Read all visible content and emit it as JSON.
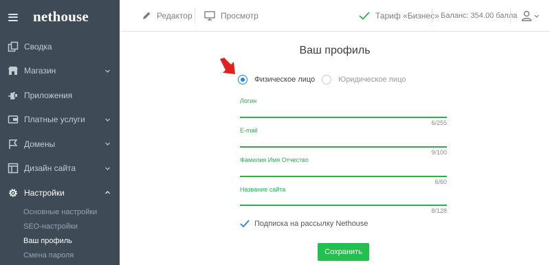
{
  "sidebar": {
    "logo": "nethouse",
    "items": [
      {
        "label": "Сводка",
        "icon": "copy-icon"
      },
      {
        "label": "Магазин",
        "icon": "store-icon"
      },
      {
        "label": "Приложения",
        "icon": "plug-icon"
      },
      {
        "label": "Платные услуги",
        "icon": "wallet-icon"
      },
      {
        "label": "Домены",
        "icon": "flag-icon"
      },
      {
        "label": "Дизайн сайта",
        "icon": "layout-icon"
      },
      {
        "label": "Настройки",
        "icon": "gear-icon"
      }
    ],
    "subitems": [
      {
        "label": "Основные настройки"
      },
      {
        "label": "SEO-настройки"
      },
      {
        "label": "Ваш профиль"
      },
      {
        "label": "Смена пароля"
      }
    ]
  },
  "topbar": {
    "editor": "Редактор",
    "preview": "Просмотр",
    "tariff": "Тариф «Бизнес»",
    "balance": "Баланс: 354.00 балла"
  },
  "profile": {
    "title": "Ваш профиль",
    "radio_individual": "Физическое лицо",
    "radio_legal": "Юридическое лицо",
    "fields": [
      {
        "label": "Логин",
        "counter": "6/255"
      },
      {
        "label": "E-mail",
        "counter": "9/100"
      },
      {
        "label": "Фамилия Имя Отчество",
        "counter": "6/60"
      },
      {
        "label": "Название сайта",
        "counter": "8/128"
      }
    ],
    "subscribe": "Подписка на рассылку Nethouse",
    "save": "Сохранить"
  },
  "colors": {
    "sidebar_bg": "#3e4a56",
    "accent_green": "#26b14d",
    "radio_blue": "#1a85e6",
    "arrow_red": "#e02020"
  }
}
